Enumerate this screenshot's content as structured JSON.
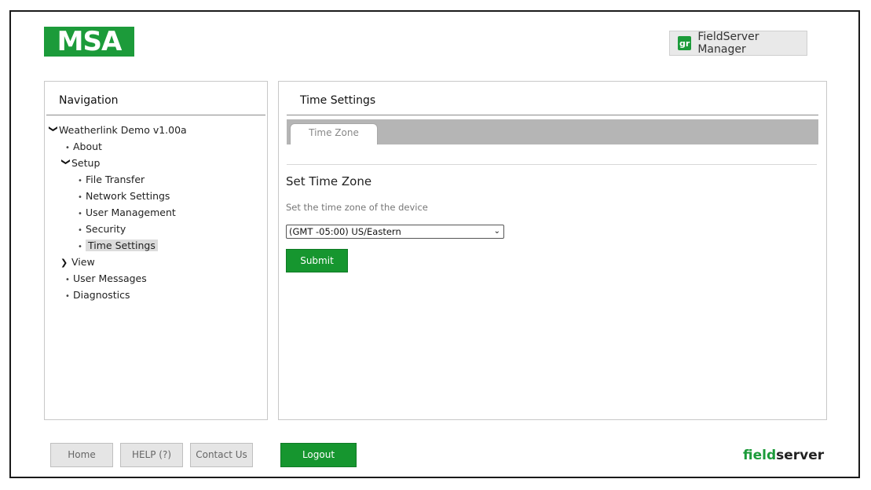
{
  "header": {
    "logo_text": "MSA",
    "fsm_icon_text": "gr",
    "fsm_label": "FieldServer Manager"
  },
  "navigation": {
    "title": "Navigation",
    "root": "Weatherlink Demo v1.00a",
    "about": "About",
    "setup": "Setup",
    "setup_children": [
      "File Transfer",
      "Network Settings",
      "User Management",
      "Security",
      "Time Settings"
    ],
    "view": "View",
    "user_messages": "User Messages",
    "diagnostics": "Diagnostics",
    "selected": "Time Settings"
  },
  "main": {
    "title": "Time Settings",
    "tab_label": "Time Zone",
    "section_title": "Set Time Zone",
    "section_desc": "Set the time zone of the device",
    "timezone_value": "(GMT -05:00) US/Eastern",
    "submit_label": "Submit"
  },
  "footer": {
    "home": "Home",
    "help": "HELP (?)",
    "contact": "Contact Us",
    "logout": "Logout",
    "brand_field": "field",
    "brand_server": "server"
  },
  "colors": {
    "brand_green": "#1c9b3a",
    "button_green": "#16962f"
  }
}
